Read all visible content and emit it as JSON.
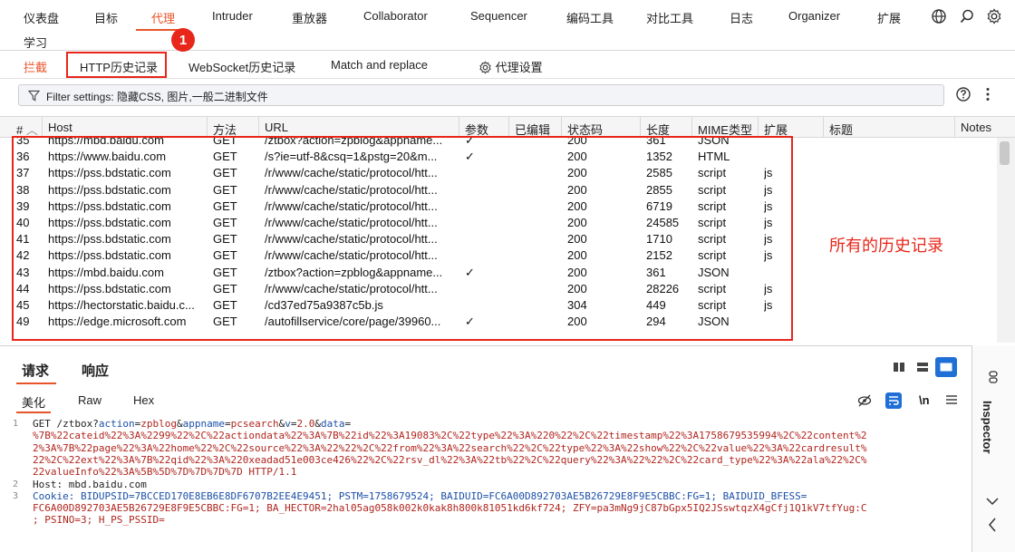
{
  "topnav": {
    "tabs": [
      "仪表盘",
      "目标",
      "代理",
      "Intruder",
      "重放器",
      "Collaborator",
      "Sequencer",
      "编码工具",
      "对比工具",
      "日志",
      "Organizer",
      "扩展"
    ],
    "study": "学习",
    "badge": "1",
    "icons": [
      "globe-icon",
      "search-icon",
      "gear-icon"
    ]
  },
  "subnav": {
    "intercept": "拦截",
    "http_history": "HTTP历史记录",
    "websocket": "WebSocket历史记录",
    "match_replace": "Match and replace",
    "proxy_settings": "代理设置"
  },
  "filter": {
    "text": "Filter settings: 隐藏CSS, 图片,一般二进制文件"
  },
  "table": {
    "headers": [
      "#",
      "Host",
      "方法",
      "URL",
      "参数",
      "已编辑",
      "状态码",
      "长度",
      "MIME类型",
      "扩展",
      "标题",
      "Notes"
    ],
    "rows": [
      {
        "id": "35",
        "host": "https://mbd.baidu.com",
        "method": "GET",
        "url": "/ztbox?action=zpblog&appname...",
        "params": "✓",
        "status": "200",
        "length": "361",
        "mime": "JSON",
        "ext": ""
      },
      {
        "id": "36",
        "host": "https://www.baidu.com",
        "method": "GET",
        "url": "/s?ie=utf-8&csq=1&pstg=20&m...",
        "params": "✓",
        "status": "200",
        "length": "1352",
        "mime": "HTML",
        "ext": ""
      },
      {
        "id": "37",
        "host": "https://pss.bdstatic.com",
        "method": "GET",
        "url": "/r/www/cache/static/protocol/htt...",
        "params": "",
        "status": "200",
        "length": "2585",
        "mime": "script",
        "ext": "js"
      },
      {
        "id": "38",
        "host": "https://pss.bdstatic.com",
        "method": "GET",
        "url": "/r/www/cache/static/protocol/htt...",
        "params": "",
        "status": "200",
        "length": "2855",
        "mime": "script",
        "ext": "js"
      },
      {
        "id": "39",
        "host": "https://pss.bdstatic.com",
        "method": "GET",
        "url": "/r/www/cache/static/protocol/htt...",
        "params": "",
        "status": "200",
        "length": "6719",
        "mime": "script",
        "ext": "js"
      },
      {
        "id": "40",
        "host": "https://pss.bdstatic.com",
        "method": "GET",
        "url": "/r/www/cache/static/protocol/htt...",
        "params": "",
        "status": "200",
        "length": "24585",
        "mime": "script",
        "ext": "js"
      },
      {
        "id": "41",
        "host": "https://pss.bdstatic.com",
        "method": "GET",
        "url": "/r/www/cache/static/protocol/htt...",
        "params": "",
        "status": "200",
        "length": "1710",
        "mime": "script",
        "ext": "js"
      },
      {
        "id": "42",
        "host": "https://pss.bdstatic.com",
        "method": "GET",
        "url": "/r/www/cache/static/protocol/htt...",
        "params": "",
        "status": "200",
        "length": "2152",
        "mime": "script",
        "ext": "js"
      },
      {
        "id": "43",
        "host": "https://mbd.baidu.com",
        "method": "GET",
        "url": "/ztbox?action=zpblog&appname...",
        "params": "✓",
        "status": "200",
        "length": "361",
        "mime": "JSON",
        "ext": ""
      },
      {
        "id": "44",
        "host": "https://pss.bdstatic.com",
        "method": "GET",
        "url": "/r/www/cache/static/protocol/htt...",
        "params": "",
        "status": "200",
        "length": "28226",
        "mime": "script",
        "ext": "js"
      },
      {
        "id": "45",
        "host": "https://hectorstatic.baidu.c...",
        "method": "GET",
        "url": "/cd37ed75a9387c5b.js",
        "params": "",
        "status": "304",
        "length": "449",
        "mime": "script",
        "ext": "js"
      },
      {
        "id": "49",
        "host": "https://edge.microsoft.com",
        "method": "GET",
        "url": "/autofillservice/core/page/39960...",
        "params": "✓",
        "status": "200",
        "length": "294",
        "mime": "JSON",
        "ext": ""
      }
    ]
  },
  "annotation": "所有的历史记录",
  "bottom": {
    "request_tab": "请求",
    "response_tab": "响应",
    "format_tabs": [
      "美化",
      "Raw",
      "Hex"
    ],
    "inspector": "Inspector",
    "lines": [
      {
        "n": "1",
        "parts": [
          "GET /ztbox?",
          "action",
          "=",
          "zpblog",
          "&",
          "appname",
          "=",
          "pcsearch",
          "&",
          "v",
          "=",
          "2.0",
          "&",
          "data",
          "="
        ]
      },
      {
        "n": "",
        "text": "%7B%22cateid%22%3A%2299%22%2C%22actiondata%22%3A%7B%22id%22%3A19083%2C%22type%22%3A%220%22%2C%22timestamp%22%3A1758679535994%2C%22content%2"
      },
      {
        "n": "",
        "text": "2%3A%7B%22page%22%3A%22home%22%2C%22source%22%3A%22%22%2C%22from%22%3A%22search%22%2C%22type%22%3A%22show%22%2C%22value%22%3A%22cardresult%"
      },
      {
        "n": "",
        "text": "22%2C%22ext%22%3A%7B%22qid%22%3A%220xeadad51e003ce426%22%2C%22rsv_dl%22%3A%22tb%22%2C%22query%22%3A%22%22%2C%22card_type%22%3A%22ala%22%2C%"
      },
      {
        "n": "",
        "text": "22valueInfo%22%3A%5B%5D%7D%7D%7D%7D HTTP/1.1"
      },
      {
        "n": "2",
        "text": "Host: mbd.baidu.com"
      },
      {
        "n": "3",
        "text": "Cookie: BIDUPSID=7BCCED170E8EB6E8DF6707B2EE4E9451; PSTM=1758679524; BAIDUID=FC6A00D892703AE5B26729E8F9E5CBBC:FG=1; BAIDUID_BFESS="
      },
      {
        "n": "",
        "text": "FC6A00D892703AE5B26729E8F9E5CBBC:FG=1; BA_HECTOR=2hal05ag058k002k0kak8h800k81051kd6kf724; ZFY=pa3mNg9jC87bGpx5IQ2JSswtqzX4gCfj1Q1kV7tfYug:C"
      },
      {
        "n": "",
        "text": "; PSINO=3; H_PS_PSSID="
      }
    ]
  }
}
